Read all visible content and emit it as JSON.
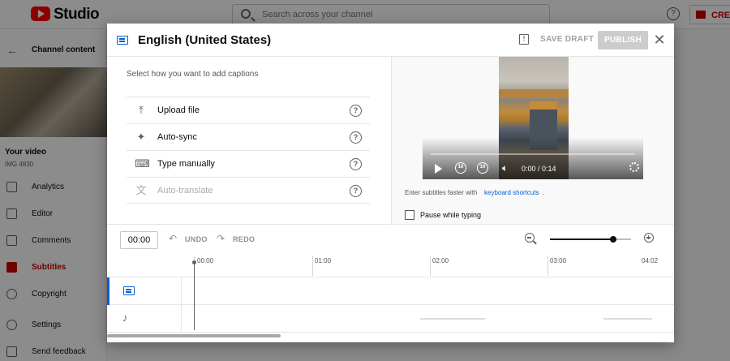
{
  "background": {
    "brand": "Studio",
    "search_placeholder": "Search across your channel",
    "help": "?",
    "create_label": "CREA",
    "sidebar": {
      "back_label": "Channel content",
      "your_video": "Your video",
      "video_name": "IMG 4830",
      "nav": [
        "Analytics",
        "Editor",
        "Comments",
        "Subtitles",
        "Copyright",
        "Settings",
        "Send feedback"
      ],
      "active": "Subtitles"
    }
  },
  "modal": {
    "title": "English (United States)",
    "save_draft": "SAVE DRAFT",
    "publish": "PUBLISH",
    "close": "✕",
    "feedback_icon": "!",
    "prompt": "Select how you want to add captions",
    "options": [
      {
        "label": "Upload file",
        "icon": "upload-icon",
        "glyph": "⤒",
        "enabled": true
      },
      {
        "label": "Auto-sync",
        "icon": "sparkle-icon",
        "glyph": "✦",
        "enabled": true
      },
      {
        "label": "Type manually",
        "icon": "keyboard-icon",
        "glyph": "⌨",
        "enabled": true
      },
      {
        "label": "Auto-translate",
        "icon": "translate-icon",
        "glyph": "文",
        "enabled": false
      }
    ],
    "help_glyph": "?",
    "player": {
      "time": "0:00 / 0:14",
      "progress": 0.0,
      "rewind": "10",
      "forward": "10"
    },
    "hint_text": "Enter subtitles faster with",
    "hint_link": "keyboard shortcuts",
    "hint_end": ".",
    "pause_label": "Pause while typing",
    "pause_checked": false,
    "timeline": {
      "current_time": "00:00",
      "undo": "UNDO",
      "redo": "REDO",
      "zoom_level": 0.78,
      "ticks": [
        "00:00",
        "01:00",
        "02:00",
        "03:00",
        "04:02"
      ]
    }
  },
  "colors": {
    "accent": "#065fd4",
    "brand_red": "#ff0000",
    "disabled": "#aaaaaa"
  }
}
